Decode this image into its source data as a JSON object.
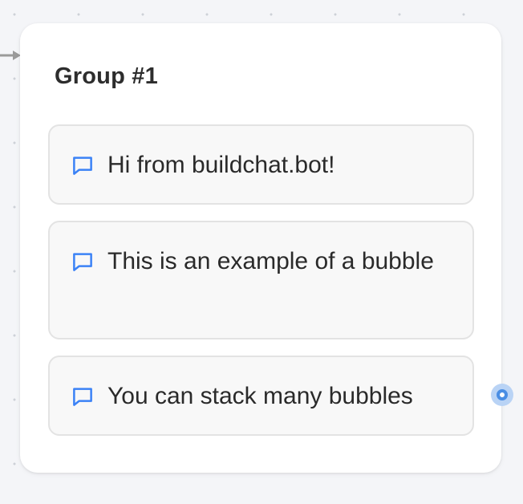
{
  "colors": {
    "canvas": "#f4f5f8",
    "card": "#ffffff",
    "bubble_bg": "#f8f8f8",
    "bubble_border": "#e3e3e3",
    "accent": "#3b82f6",
    "edge": "#9a9a9a"
  },
  "group": {
    "title": "Group #1",
    "bubbles": [
      {
        "icon": "chat-bubble-icon",
        "text": "Hi from buildchat.bot!"
      },
      {
        "icon": "chat-bubble-icon",
        "text": "This is an example of a bubble"
      },
      {
        "icon": "chat-bubble-icon",
        "text": "You can stack many bubbles"
      }
    ]
  },
  "icons": {
    "incoming": "arrow-right-icon",
    "output": "output-handle-icon"
  }
}
